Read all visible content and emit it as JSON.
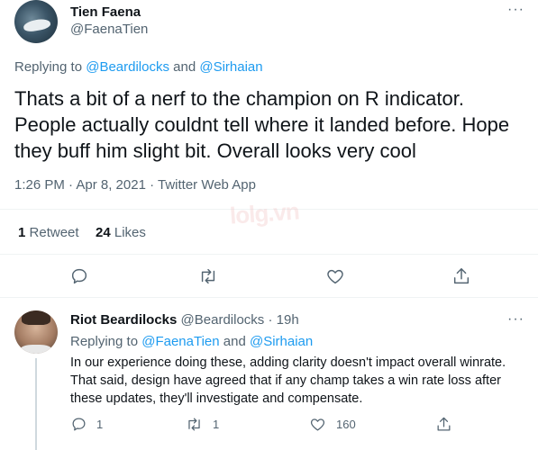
{
  "tweet": {
    "author_name": "Tien Faena",
    "author_handle": "@FaenaTien",
    "replying_prefix": "Replying to",
    "replying_user1": "@Beardilocks",
    "replying_and": "and",
    "replying_user2": "@Sirhaian",
    "text": "Thats a bit of a nerf to the champion on R indicator. People actually couldnt tell where it landed before. Hope they buff him slight bit. Overall looks very cool",
    "timestamp": "1:26 PM · Apr 8, 2021 · Twitter Web App",
    "retweets_count": "1",
    "retweets_label": "Retweet",
    "likes_count": "24",
    "likes_label": "Likes",
    "more": "···"
  },
  "reply": {
    "author_name": "Riot Beardilocks",
    "author_handle": "@Beardilocks",
    "time": "· 19h",
    "replying_prefix": "Replying to",
    "replying_user1": "@FaenaTien",
    "replying_and": "and",
    "replying_user2": "@Sirhaian",
    "text": "In our experience doing these, adding clarity doesn't impact overall winrate. That said, design have agreed that if any champ takes a win rate loss after these updates, they'll investigate and compensate.",
    "reply_count": "1",
    "retweet_count": "1",
    "like_count": "160",
    "more": "···"
  },
  "watermark": "lolg.vn",
  "icons": [
    "reply-icon",
    "retweet-icon",
    "like-icon",
    "share-icon",
    "more-icon"
  ],
  "colors": {
    "link": "#1d9bf0",
    "muted": "#536471",
    "text": "#0f1419",
    "divider": "#eff3f4"
  }
}
